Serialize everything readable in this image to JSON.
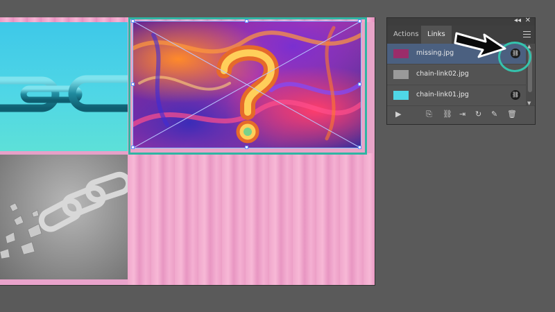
{
  "panel": {
    "tabs": [
      {
        "label": "Actions",
        "active": false
      },
      {
        "label": "Links",
        "active": true
      }
    ],
    "links": [
      {
        "name": "missing.jpg",
        "selected": true,
        "thumb_color": "#9b2d6a",
        "linked": true
      },
      {
        "name": "chain-link02.jpg",
        "selected": false,
        "thumb_color": "#9a9a9a",
        "linked": false
      },
      {
        "name": "chain-link01.jpg",
        "selected": false,
        "thumb_color": "#4fd6e6",
        "linked": true
      }
    ],
    "toolbar_icons": [
      "play-icon",
      "relink-from-cc-icon",
      "relink-icon",
      "go-to-link-icon",
      "update-link-icon",
      "edit-original-icon",
      "delete-icon"
    ]
  },
  "colors": {
    "callout": "#35c3ad",
    "selection_frame": "#2fb5a3",
    "selected_row": "#4b6080"
  }
}
